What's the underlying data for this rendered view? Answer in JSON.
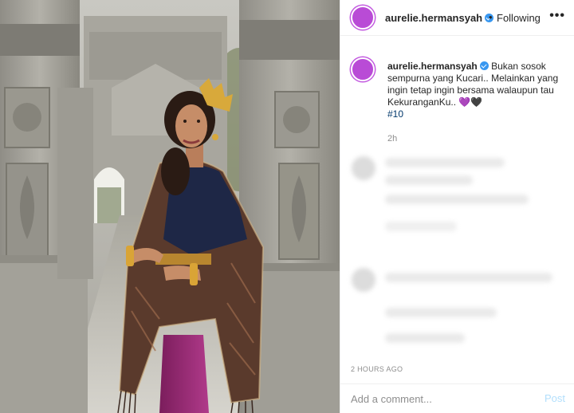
{
  "post": {
    "username": "aurelie.hermansyah",
    "separator": "•",
    "follow_status": "Following",
    "more_icon": "more-horizontal-icon",
    "verified_icon": "verified-badge-icon"
  },
  "caption": {
    "username": "aurelie.hermansyah",
    "text": "Bukan sosok sempurna yang Kucari.. Melainkan yang ingin tetap ingin bersama walaupun tau KekuranganKu..",
    "emoji_1": "💜",
    "emoji_2": "🖤",
    "hashtag": "#10",
    "time_ago": "2h"
  },
  "footer": {
    "timestamp": "2 HOURS AGO",
    "comment_placeholder": "Add a comment...",
    "post_label": "Post"
  },
  "colors": {
    "avatar": "#b94bd6",
    "verified": "#3897f0",
    "hashtag": "#00376b",
    "post_disabled": "#b2dffc"
  }
}
